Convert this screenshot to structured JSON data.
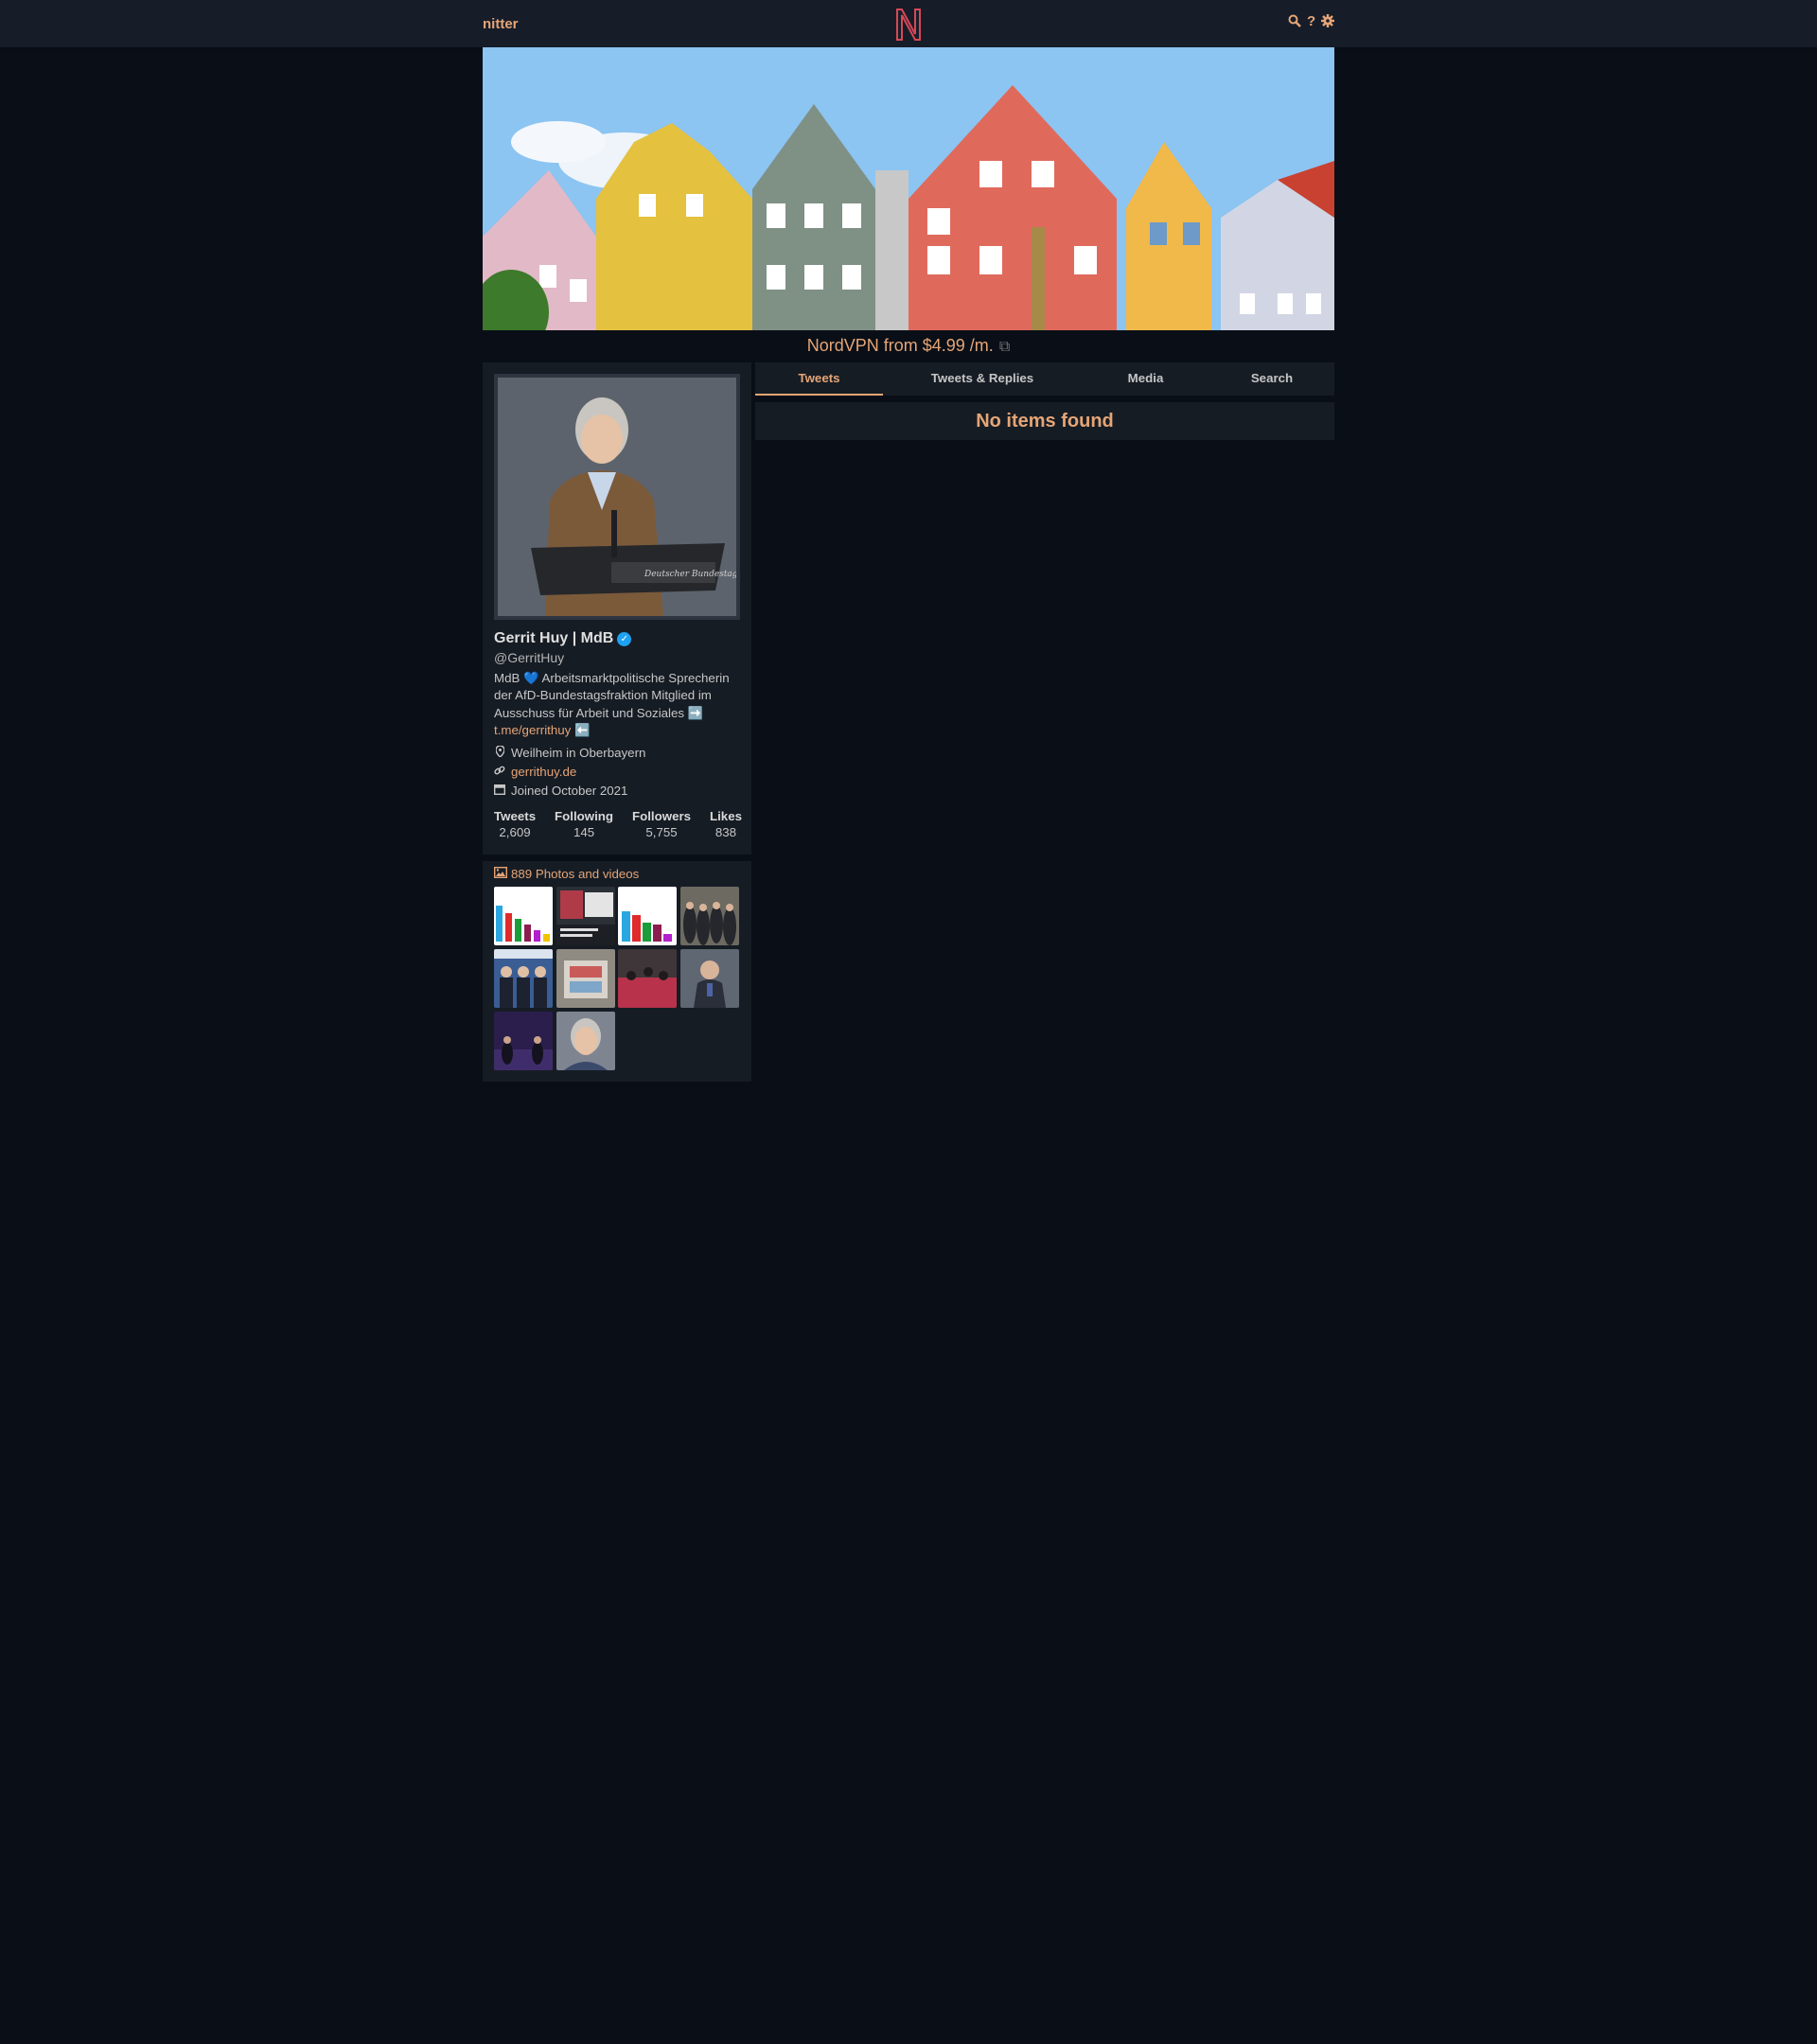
{
  "nav": {
    "logo": "nitter",
    "help_label": "?"
  },
  "ad": {
    "text": "NordVPN from $4.99 /m."
  },
  "profile": {
    "fullname": "Gerrit Huy | MdB",
    "username": "@GerritHuy",
    "bio_text": "MdB 💙 Arbeitsmarktpolitische Sprecherin der AfD-Bundestagsfraktion Mitglied im Ausschuss für Arbeit und Soziales ➡️",
    "bio_link": "t.me/gerrithuy",
    "bio_suffix": "⬅️",
    "location": "Weilheim in Oberbayern",
    "website": "gerrithuy.de",
    "joined": "Joined October 2021",
    "podium_text": "Deutscher Bundestag",
    "stats": [
      {
        "label": "Tweets",
        "value": "2,609"
      },
      {
        "label": "Following",
        "value": "145"
      },
      {
        "label": "Followers",
        "value": "5,755"
      },
      {
        "label": "Likes",
        "value": "838"
      }
    ]
  },
  "media": {
    "header": "889 Photos and videos",
    "count": 10
  },
  "tabs": [
    {
      "label": "Tweets",
      "active": true
    },
    {
      "label": "Tweets & Replies",
      "active": false
    },
    {
      "label": "Media",
      "active": false
    },
    {
      "label": "Search",
      "active": false
    }
  ],
  "timeline": {
    "empty_message": "No items found"
  },
  "colors": {
    "accent": "#e5a577",
    "background": "#0a0f17",
    "panel": "#161c24",
    "verified": "#1da1f2"
  }
}
